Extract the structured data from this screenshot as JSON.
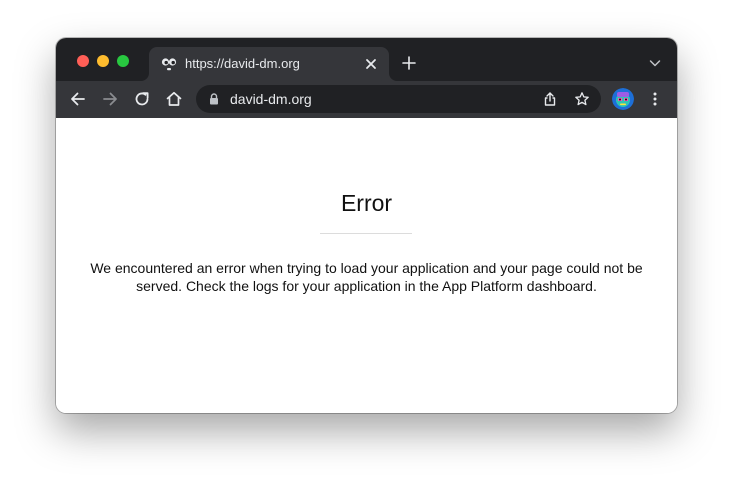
{
  "window": {
    "traffic_lights": [
      "close",
      "minimize",
      "zoom"
    ]
  },
  "tab": {
    "title": "https://david-dm.org",
    "favicon": "eyes-favicon-icon",
    "close_icon": "close-icon"
  },
  "tabstrip": {
    "new_tab_icon": "plus-icon",
    "tab_search_icon": "chevron-down-icon"
  },
  "toolbar": {
    "back_icon": "arrow-left-icon",
    "forward_icon": "arrow-right-icon",
    "reload_icon": "reload-icon",
    "home_icon": "home-icon",
    "url": "david-dm.org",
    "lock_icon": "lock-icon",
    "share_icon": "share-icon",
    "bookmark_icon": "star-icon",
    "menu_icon": "kebab-menu-icon"
  },
  "page": {
    "title": "Error",
    "message": "We encountered an error when trying to load your application and your page could not be served. Check the logs for your application in the App Platform dashboard."
  },
  "colors": {
    "tabstrip_bg": "#202124",
    "toolbar_bg": "#35363a",
    "omnibox_bg": "#202124",
    "close": "#ff5f57",
    "minimize": "#febc2e",
    "zoom": "#28c840"
  }
}
